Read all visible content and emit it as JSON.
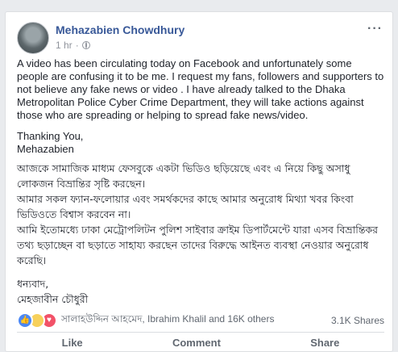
{
  "post": {
    "author": "Mehazabien Chowdhury",
    "timestamp": "1 hr",
    "english_paragraphs": [
      "A video has been circulating today on Facebook and unfortunately some people are confusing it to be me. I request my fans, followers and supporters to not believe any fake news or video . I have already talked to the Dhaka Metropolitan Police Cyber Crime Department, they will take actions against those who are spreading or helping to spread fake news/video.",
      "Thanking You,",
      "Mehazabien"
    ],
    "bangla_paragraphs": [
      "আজকে সামাজিক মাধ্যম ফেসবুকে একটা ভিডিও ছড়িয়েছে এবং এ নিয়ে কিছু অসাধু লোকজন বিভ্রান্তির সৃষ্টি করছেন।",
      "আমার সকল ফ্যান-ফলোয়ার এবং সমর্থকদের কাছে আমার অনুরোধ মিথ্যা খবর কিংবা ভিডিওতে বিশ্বাস করবেন না।",
      "আমি ইতোমধ্যে ঢাকা মেট্রোপলিটন পুলিশ সাইবার ক্রাইম ডিপার্টমেন্টে যারা এসব বিভ্রান্তিকর তথ্য ছড়াচ্ছেন বা ছড়াতে সাহায্য করছেন তাদের বিরুদ্ধে আইনত ব্যবস্থা নেওয়ার অনুরোধ করেছি।",
      "ধন্যবাদ,",
      "মেহজাবীন চৌধুরী"
    ],
    "reactions_text": "সালাহউদ্দিন আহমেদ, Ibrahim Khalil and 16K others",
    "shares": "3.1K Shares",
    "actions": [
      "Like",
      "Comment",
      "Share"
    ]
  },
  "icons": {
    "more": "more-options-icon",
    "privacy": "globe-icon",
    "reactions": [
      "like-reaction-icon",
      "sad-reaction-icon",
      "love-reaction-icon"
    ]
  },
  "colors": {
    "author": "#385898",
    "like": "#4b88f5",
    "sad": "#f7d15c",
    "love": "#f25268"
  }
}
